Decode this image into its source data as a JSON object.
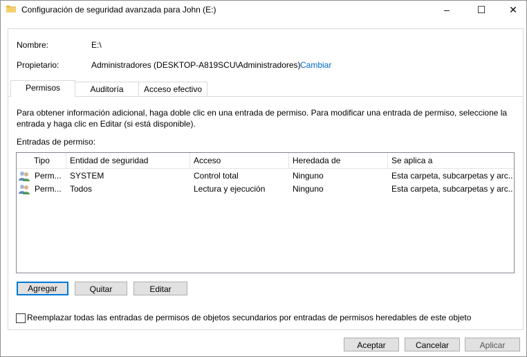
{
  "window": {
    "title": "Configuración de seguridad avanzada para John (E:)",
    "minimize_glyph": "–",
    "maximize_glyph": "☐",
    "close_glyph": "✕"
  },
  "info": {
    "name_label": "Nombre:",
    "name_value": "E:\\",
    "owner_label": "Propietario:",
    "owner_value": "Administradores (DESKTOP-A819SCU\\Administradores)",
    "change_link": "Cambiar"
  },
  "tabs": [
    {
      "label": "Permisos",
      "active": true
    },
    {
      "label": "Auditoría",
      "active": false
    },
    {
      "label": "Acceso efectivo",
      "active": false
    }
  ],
  "description": {
    "line1": "Para obtener información adicional, haga doble clic en una entrada de permiso. Para modificar una entrada de permiso, seleccione la",
    "line2": "entrada y haga clic en Editar (si está disponible)."
  },
  "entries": {
    "label": "Entradas de permiso:",
    "columns": [
      "Tipo",
      "Entidad de seguridad",
      "Acceso",
      "Heredada de",
      "Se aplica a"
    ],
    "rows": [
      {
        "icon": "users-icon",
        "tipo": "Perm...",
        "entidad": "SYSTEM",
        "acceso": "Control total",
        "heredada": "Ninguno",
        "aplica": "Esta carpeta, subcarpetas y arc..."
      },
      {
        "icon": "users-icon",
        "tipo": "Perm...",
        "entidad": "Todos",
        "acceso": "Lectura y ejecución",
        "heredada": "Ninguno",
        "aplica": "Esta carpeta, subcarpetas y arc..."
      }
    ]
  },
  "buttons": {
    "add": "Agregar",
    "remove": "Quitar",
    "edit": "Editar",
    "accept": "Aceptar",
    "cancel": "Cancelar",
    "apply": "Aplicar"
  },
  "replace_checkbox": {
    "label": "Reemplazar todas las entradas de permisos de objetos secundarios por entradas de permisos heredables de este objeto",
    "checked": false
  },
  "colors": {
    "accent": "#0078d7",
    "link": "#0066cc",
    "folder": "#e8b84a"
  }
}
